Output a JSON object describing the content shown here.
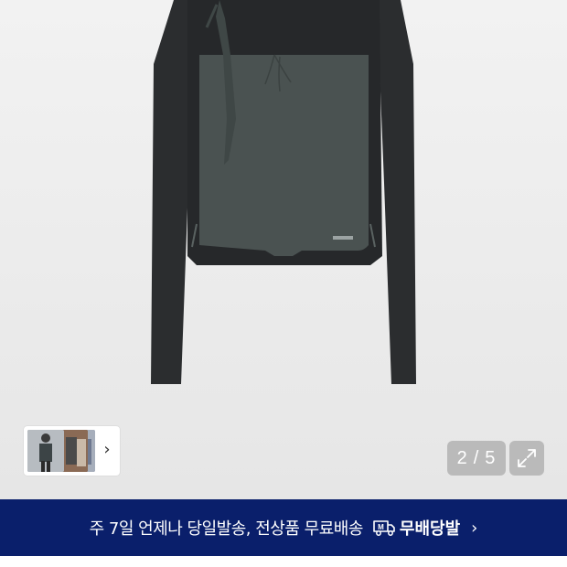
{
  "gallery": {
    "current_page": "2",
    "total_pages": "5",
    "page_separator": "/",
    "thumbnail_next": "›"
  },
  "colors": {
    "background": "#ebebeb",
    "garment_dark": "#2b2d2f",
    "garment_panel": "#4a5251",
    "banner_bg": "#0a1f6b"
  },
  "icons": {
    "expand": "expand-arrows-icon",
    "thumb_next": "chevron-right-icon",
    "delivery": "delivery-truck-icon",
    "banner_arrow": "chevron-right-icon"
  },
  "banner": {
    "text": "주 7일 언제나 당일발송, 전상품 무료배송",
    "badge_label": "무배당발",
    "truck_letter": "M",
    "chevron": "›"
  }
}
